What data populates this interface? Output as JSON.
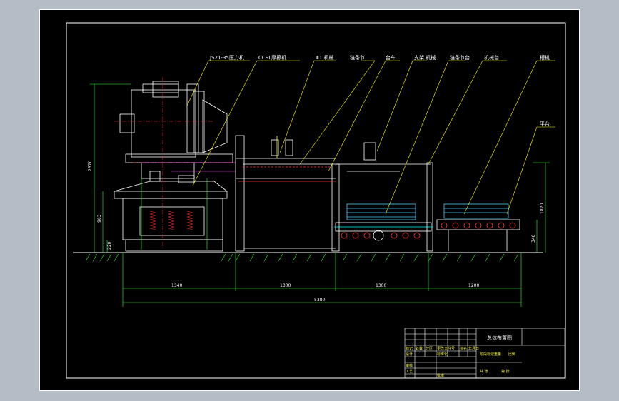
{
  "callouts": [
    {
      "text": "JS21-35压力机"
    },
    {
      "text": "CCSL摩擦机"
    },
    {
      "text": "Ⅲ1 机械"
    },
    {
      "text": "链条节"
    },
    {
      "text": "台车"
    },
    {
      "text": "支架 机械"
    },
    {
      "text": "链条节台"
    },
    {
      "text": "机械台"
    },
    {
      "text": "槽机"
    },
    {
      "text": "平台"
    }
  ],
  "dimensions": {
    "horizontal": [
      "1340",
      "1300",
      "1300",
      "1200",
      "5380"
    ],
    "vertical": [
      "2370",
      "963",
      "220",
      "1820",
      "340"
    ]
  },
  "title_block": {
    "drawing_title": "总体布置图",
    "cells": [
      "标记",
      "处数",
      "分区",
      "更改文件号",
      "签名",
      "年月日",
      "设计",
      "标准化",
      "审核",
      "工艺",
      "批准",
      "阶段标记",
      "重量",
      "比例",
      "共 张",
      "第 张"
    ]
  },
  "colors": {
    "background": "#000000",
    "frame": "#ffffff",
    "machine": "#ffffff",
    "center_lines": "#ff3030",
    "dimension_lines": "#39ff39",
    "leaders": "#ffff00",
    "equipment_blue": "#40d0ff",
    "cyan": "#00ffff",
    "magenta": "#ff44ff"
  }
}
